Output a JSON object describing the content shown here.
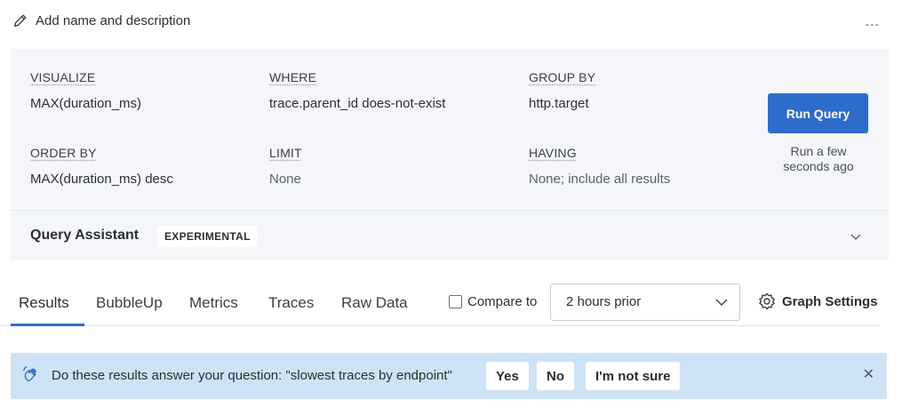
{
  "header": {
    "edit_label": "Add name and description",
    "more_label": "..."
  },
  "query": {
    "visualize": {
      "label": "VISUALIZE",
      "value": "MAX(duration_ms)"
    },
    "where": {
      "label": "WHERE",
      "value": "trace.parent_id does-not-exist"
    },
    "group_by": {
      "label": "GROUP BY",
      "value": "http.target"
    },
    "order_by": {
      "label": "ORDER BY",
      "value": "MAX(duration_ms) desc"
    },
    "limit": {
      "label": "LIMIT",
      "value": "None"
    },
    "having": {
      "label": "HAVING",
      "value": "None; include all results"
    },
    "run_button": "Run Query",
    "run_status": "Run a few seconds ago"
  },
  "assistant": {
    "title": "Query Assistant",
    "badge": "EXPERIMENTAL"
  },
  "tabs": [
    {
      "label": "Results",
      "active": true
    },
    {
      "label": "BubbleUp",
      "active": false
    },
    {
      "label": "Metrics",
      "active": false
    },
    {
      "label": "Traces",
      "active": false
    },
    {
      "label": "Raw Data",
      "active": false
    }
  ],
  "compare": {
    "label": "Compare to",
    "checked": false,
    "selected": "2 hours prior"
  },
  "graph_settings": "Graph Settings",
  "feedback": {
    "question": "Do these results answer your question: \"slowest traces by endpoint\"",
    "yes": "Yes",
    "no": "No",
    "not_sure": "I'm not sure",
    "close": "✕"
  },
  "colors": {
    "accent": "#2d6cc8",
    "panel_bg": "#f4f6f9",
    "feedback_bg": "#cde3f5"
  }
}
